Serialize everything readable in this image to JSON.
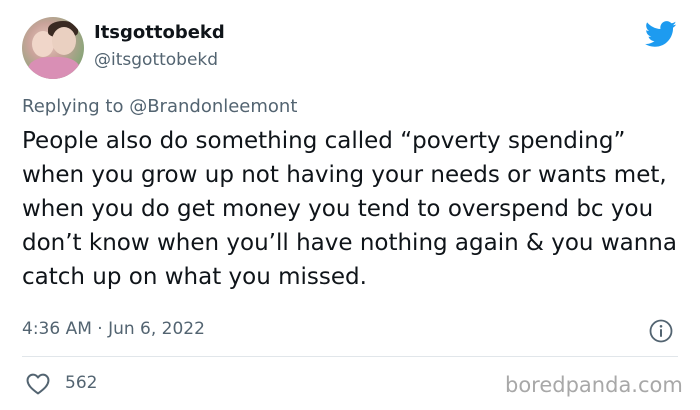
{
  "user": {
    "display_name": "Itsgottobekd",
    "handle": "@itsgottobekd"
  },
  "reply_to": "Replying to @Brandonleemont",
  "tweet_text": "People also do something called “poverty spending” when you grow up not having your needs or wants met, when you do get money you tend to overspend bc you don’t know when you’ll have nothing again & you wanna catch up on what you missed.",
  "timestamp": "4:36 AM · Jun 6, 2022",
  "likes": "562",
  "watermark": "boredpanda.com",
  "icons": {
    "logo": "twitter-bird-icon",
    "info": "info-icon",
    "like": "heart-icon"
  },
  "colors": {
    "twitter_blue": "#1d9bf0",
    "secondary_text": "#536471",
    "primary_text": "#0f1419"
  }
}
